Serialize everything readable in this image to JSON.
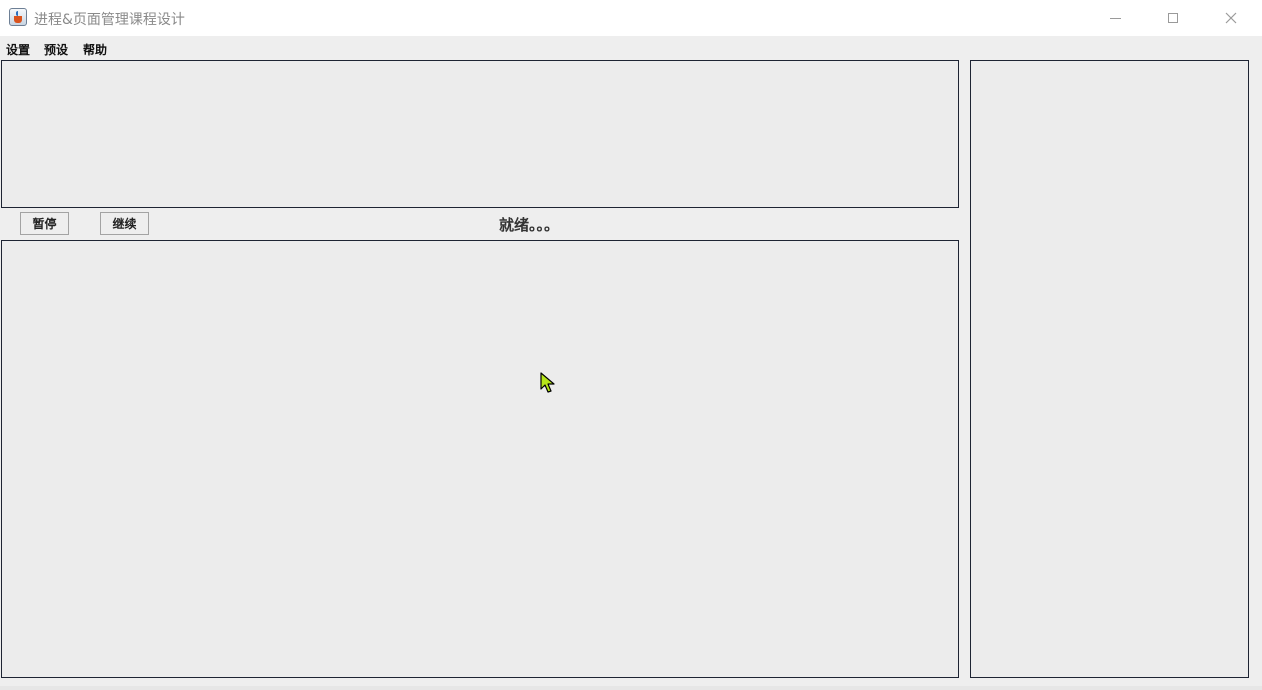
{
  "window": {
    "title": "进程&页面管理课程设计",
    "controls": {
      "minimize_icon": "minimize-icon",
      "maximize_icon": "maximize-icon",
      "close_icon": "close-icon"
    }
  },
  "menubar": {
    "items": [
      {
        "label": "设置"
      },
      {
        "label": "预设"
      },
      {
        "label": "帮助"
      }
    ]
  },
  "controls": {
    "pause_label": "暂停",
    "resume_label": "继续"
  },
  "status": {
    "text": "就绪。。。"
  },
  "colors": {
    "background": "#eeeeee",
    "panel_border": "#1e2433",
    "cursor_fill": "#b6e51a"
  }
}
